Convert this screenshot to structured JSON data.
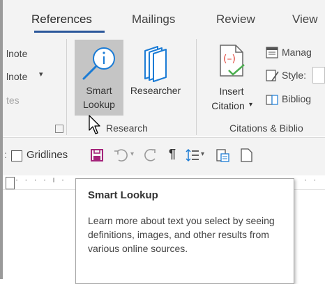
{
  "tabs": [
    {
      "label": "References",
      "active": true
    },
    {
      "label": "Mailings",
      "active": false
    },
    {
      "label": "Review",
      "active": false
    },
    {
      "label": "View",
      "active": false
    }
  ],
  "left_group": {
    "item1": "lnote",
    "item2": "lnote",
    "item3": "tes"
  },
  "research_group": {
    "smart_lookup_line1": "Smart",
    "smart_lookup_line2": "Lookup",
    "researcher": "Researcher",
    "group_label": "Research"
  },
  "citations_group": {
    "insert_citation_line1": "Insert",
    "insert_citation_line2": "Citation",
    "manage": "Manag",
    "style": "Style:",
    "bibliography": "Bibliog",
    "group_label": "Citations & Biblio"
  },
  "qat": {
    "gridlines_label": "Gridlines",
    "gridlines_checked": false
  },
  "tooltip": {
    "title": "Smart Lookup",
    "body": "Learn more about text you select by seeing definitions, images, and other results from various online sources."
  },
  "colors": {
    "accent": "#2b579a",
    "save_icon": "#a4247a",
    "insert_citation_red": "#e0453b",
    "icon_blue": "#1c7cd5",
    "hover_bg": "#c5c5c5"
  }
}
